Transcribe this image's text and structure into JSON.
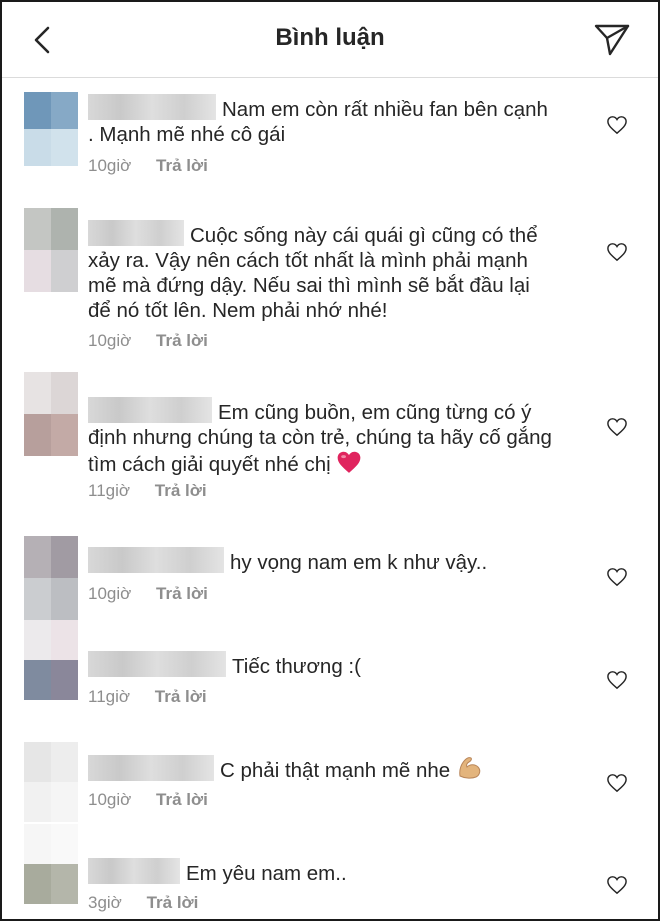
{
  "header": {
    "title": "Bình luận",
    "back_icon": "chevron-left-icon",
    "send_icon": "paper-plane-icon"
  },
  "comments": [
    {
      "text": "Nam em còn rất nhiều fan bên cạnh . Mạnh mẽ nhé cô gái",
      "time": "10giờ",
      "reply": "Trả lời"
    },
    {
      "text": "Cuộc sống này cái quái gì cũng có thể xảy ra. Vậy nên cách tốt nhất là mình phải mạnh mẽ mà đứng dậy. Nếu sai thì mình sẽ bắt đầu lại để nó tốt lên. Nem phải nhớ nhé!",
      "time": "10giờ",
      "reply": "Trả lời"
    },
    {
      "text": "Em cũng buồn, em cũng từng có ý định nhưng chúng ta còn trẻ, chúng ta hãy cố gắng tìm cách giải quyết nhé chị",
      "emoji": "❤️",
      "time": "11giờ",
      "reply": "Trả lời"
    },
    {
      "text": "hy vọng nam em k như vậy..",
      "time": "10giờ",
      "reply": "Trả lời"
    },
    {
      "text": "Tiếc thương :(",
      "time": "11giờ",
      "reply": "Trả lời"
    },
    {
      "text": "C phải thật mạnh mẽ nhe",
      "emoji": "💪",
      "time": "10giờ",
      "reply": "Trả lời"
    },
    {
      "text": "Em yêu nam em..",
      "time": "3giờ",
      "reply": "Trả lời"
    }
  ],
  "colors": {
    "text": "#262626",
    "meta": "#8e8e8e",
    "divider": "#dbdbdb",
    "heart_emoji": "#e0245e"
  }
}
